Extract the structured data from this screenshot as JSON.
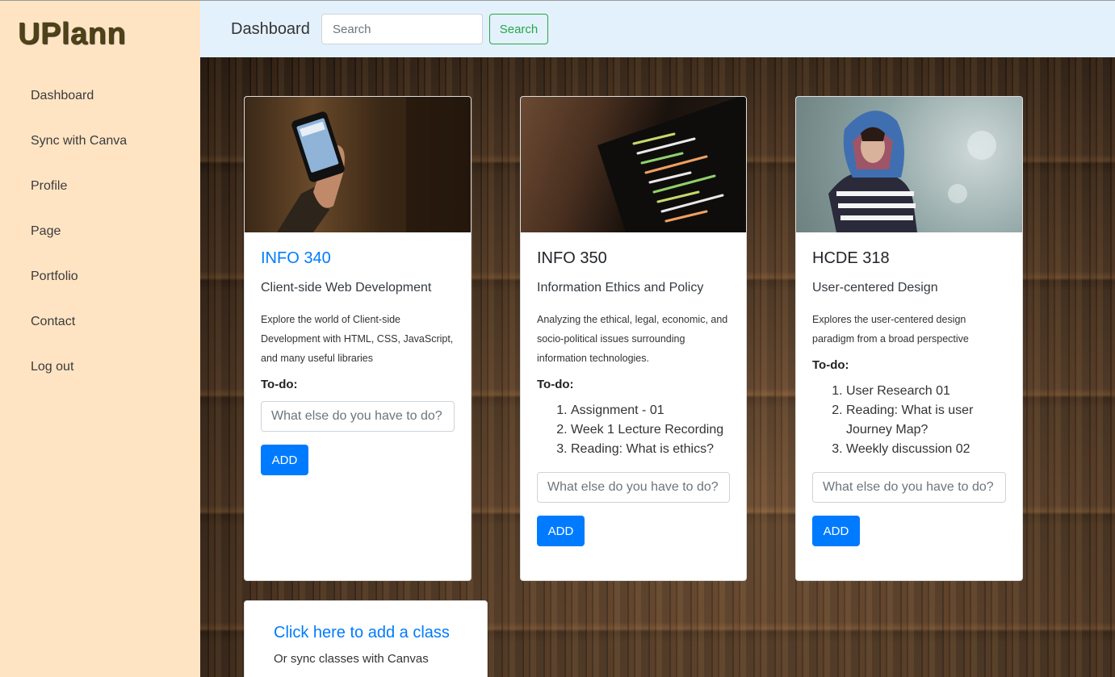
{
  "app": {
    "logo": "UPlann"
  },
  "sidebar": {
    "items": [
      {
        "label": "Dashboard"
      },
      {
        "label": "Sync with Canva"
      },
      {
        "label": "Profile"
      },
      {
        "label": "Page"
      },
      {
        "label": "Portfolio"
      },
      {
        "label": "Contact"
      },
      {
        "label": "Log out"
      }
    ]
  },
  "header": {
    "title": "Dashboard",
    "search_placeholder": "Search",
    "search_button": "Search"
  },
  "courses": [
    {
      "code": "INFO 340",
      "name": "Client-side Web Development",
      "description": "Explore the world of Client-side Development with HTML, CSS, JavaScript, and many useful libraries",
      "todo_label": "To-do:",
      "todos": [],
      "input_placeholder": "What else do you have to do?",
      "add_label": "ADD"
    },
    {
      "code": "INFO 350",
      "name": "Information Ethics and Policy",
      "description": "Analyzing the ethical, legal, economic, and socio-political issues surrounding information technologies.",
      "todo_label": "To-do:",
      "todos": [
        "Assignment - 01",
        "Week 1 Lecture Recording",
        "Reading: What is ethics?"
      ],
      "input_placeholder": "What else do you have to do?",
      "add_label": "ADD"
    },
    {
      "code": "HCDE 318",
      "name": "User-centered Design",
      "description": "Explores the user-centered design paradigm from a broad perspective",
      "todo_label": "To-do:",
      "todos": [
        "User Research 01",
        "Reading: What is user Journey Map?",
        "Weekly discussion 02"
      ],
      "input_placeholder": "What else do you have to do?",
      "add_label": "ADD"
    }
  ],
  "add_class": {
    "title": "Click here to add a class",
    "subtitle": "Or sync classes with Canvas"
  },
  "colors": {
    "sidebar_bg": "#ffe4c4",
    "header_bg": "#e3f1fd",
    "primary": "#007bff",
    "success": "#28a745",
    "logo": "#4f4316"
  }
}
